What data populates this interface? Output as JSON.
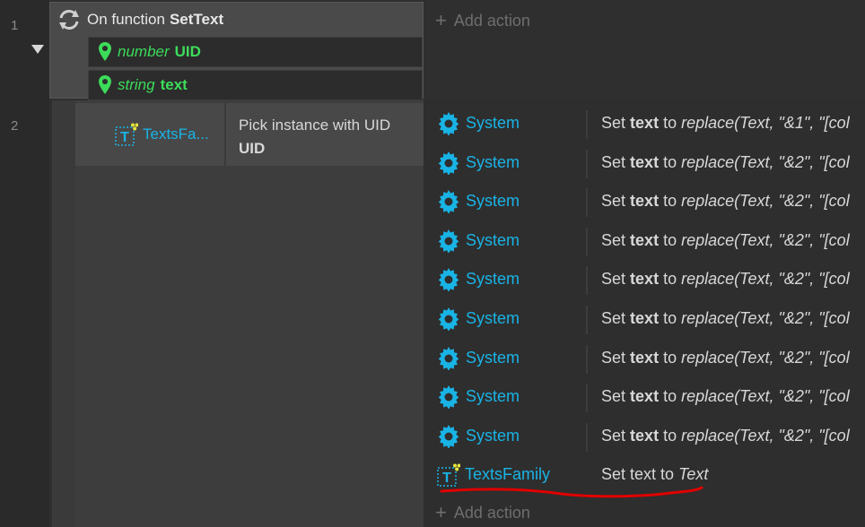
{
  "rows": {
    "num1": "1",
    "num2": "2"
  },
  "event1": {
    "trigger_prefix": "On function",
    "function_name": "SetText",
    "params": [
      {
        "type": "number",
        "name": "UID"
      },
      {
        "type": "string",
        "name": "text"
      }
    ]
  },
  "add_action_label": "Add action",
  "event2": {
    "condition": {
      "object": "TextsFa...",
      "line1": "Pick instance with UID",
      "line2": "UID"
    },
    "actions": [
      {
        "object": "System",
        "set": "Set",
        "var": "text",
        "to": "to",
        "expr": "replace(Text, \"&1\", \"[col"
      },
      {
        "object": "System",
        "set": "Set",
        "var": "text",
        "to": "to",
        "expr": "replace(Text, \"&2\", \"[col"
      },
      {
        "object": "System",
        "set": "Set",
        "var": "text",
        "to": "to",
        "expr": "replace(Text, \"&2\", \"[col"
      },
      {
        "object": "System",
        "set": "Set",
        "var": "text",
        "to": "to",
        "expr": "replace(Text, \"&2\", \"[col"
      },
      {
        "object": "System",
        "set": "Set",
        "var": "text",
        "to": "to",
        "expr": "replace(Text, \"&2\", \"[col"
      },
      {
        "object": "System",
        "set": "Set",
        "var": "text",
        "to": "to",
        "expr": "replace(Text, \"&2\", \"[col"
      },
      {
        "object": "System",
        "set": "Set",
        "var": "text",
        "to": "to",
        "expr": "replace(Text, \"&2\", \"[col"
      },
      {
        "object": "System",
        "set": "Set",
        "var": "text",
        "to": "to",
        "expr": "replace(Text, \"&2\", \"[col"
      },
      {
        "object": "System",
        "set": "Set",
        "var": "text",
        "to": "to",
        "expr": "replace(Text, \"&2\", \"[col"
      }
    ],
    "last_action": {
      "object": "TextsFamily",
      "text": "Set text to",
      "expr": "Text"
    }
  },
  "colors": {
    "object_link": "#19b4e6",
    "param": "#3cdc5a",
    "annotation": "#e00000"
  },
  "icons": {
    "trigger": "function-refresh-icon",
    "param": "map-pin-icon",
    "system": "gear-icon",
    "family": "text-family-icon"
  }
}
